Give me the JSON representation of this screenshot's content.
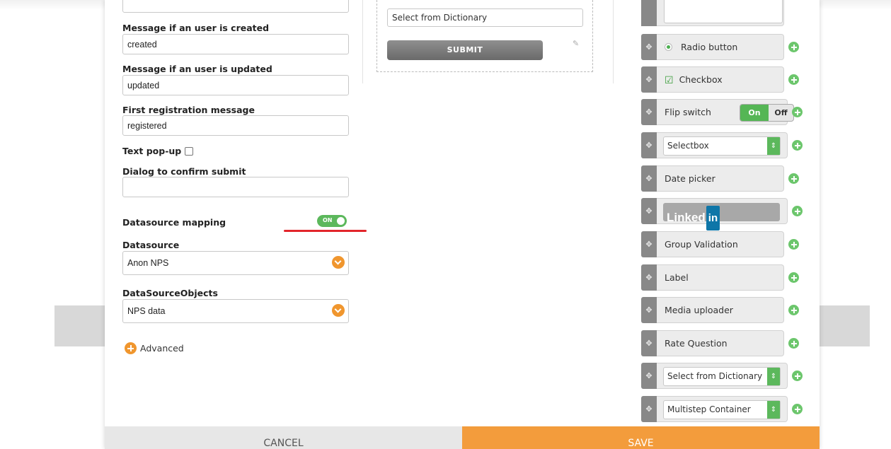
{
  "left": {
    "msg_created_label": "Message if an user is created",
    "msg_created_value": "created",
    "msg_updated_label": "Message if an user is updated",
    "msg_updated_value": "updated",
    "first_reg_label": "First registration message",
    "first_reg_value": "registered",
    "text_popup_label": "Text pop-up",
    "dialog_label": "Dialog to confirm submit",
    "dialog_value": "",
    "ds_mapping_label": "Datasource mapping",
    "ds_mapping_toggle": "ON",
    "datasource_label": "Datasource",
    "datasource_value": "Anon NPS",
    "dso_label": "DataSourceObjects",
    "dso_value": "NPS data",
    "advanced_label": "Advanced"
  },
  "middle": {
    "select_dict_value": "Select from Dictionary",
    "submit_label": "SUBMIT"
  },
  "widgets": {
    "radio": "Radio button",
    "checkbox": "Checkbox",
    "flip_label": "Flip switch",
    "flip_on": "On",
    "flip_off": "Off",
    "selectbox": "Selectbox",
    "date_picker": "Date picker",
    "linkedin_word": "Linked",
    "linkedin_in": "in",
    "group_validation": "Group Validation",
    "label": "Label",
    "media_uploader": "Media uploader",
    "rate_question": "Rate Question",
    "select_dict": "Select from Dictionary",
    "multistep": "Multistep Container"
  },
  "footer": {
    "cancel": "CANCEL",
    "save": "SAVE"
  },
  "colors": {
    "accent_orange": "#f39c3c",
    "toggle_green": "#5cb85c",
    "underline_red": "#e2252b"
  }
}
